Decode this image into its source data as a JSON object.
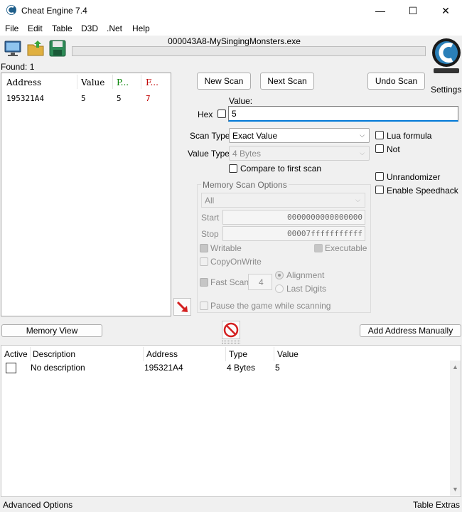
{
  "window": {
    "title": "Cheat Engine 7.4",
    "minimize": "—",
    "maximize": "☐",
    "close": "✕"
  },
  "menu": [
    "File",
    "Edit",
    "Table",
    "D3D",
    ".Net",
    "Help"
  ],
  "toolbar": {
    "process_name": "000043A8-MySingingMonsters.exe",
    "settings_label": "Settings",
    "logo_text": "Cheat Engine"
  },
  "found": {
    "label": "Found: 1"
  },
  "results": {
    "headers": [
      "Address",
      "Value",
      "P...",
      "F..."
    ],
    "rows": [
      {
        "address": "195321A4",
        "value": "5",
        "previous": "5",
        "first": "7"
      }
    ]
  },
  "scan": {
    "new_scan": "New Scan",
    "next_scan": "Next Scan",
    "undo_scan": "Undo Scan",
    "value_label": "Value:",
    "hex_label": "Hex",
    "value": "5",
    "scan_type_label": "Scan Type",
    "scan_type": "Exact Value",
    "value_type_label": "Value Type",
    "value_type": "4 Bytes",
    "compare_first": "Compare to first scan",
    "lua_formula": "Lua formula",
    "not": "Not",
    "unrandomizer": "Unrandomizer",
    "speedhack": "Enable Speedhack"
  },
  "memory_options": {
    "title": "Memory Scan Options",
    "region": "All",
    "start_label": "Start",
    "start": "0000000000000000",
    "stop_label": "Stop",
    "stop": "00007fffffffffff",
    "writable": "Writable",
    "executable": "Executable",
    "copy_on_write": "CopyOnWrite",
    "fast_scan": "Fast Scan",
    "fast_scan_value": "4",
    "alignment": "Alignment",
    "last_digits": "Last Digits",
    "pause_game": "Pause the game while scanning"
  },
  "bottom_buttons": {
    "memory_view": "Memory View",
    "add_address": "Add Address Manually"
  },
  "address_table": {
    "headers": [
      "Active",
      "Description",
      "Address",
      "Type",
      "Value"
    ],
    "rows": [
      {
        "description": "No description",
        "address": "195321A4",
        "type": "4 Bytes",
        "value": "5"
      }
    ]
  },
  "status": {
    "advanced": "Advanced Options",
    "extras": "Table Extras"
  },
  "colors": {
    "previous_col": "#008000",
    "first_col": "#ff0000",
    "accent": "#0078d7"
  }
}
